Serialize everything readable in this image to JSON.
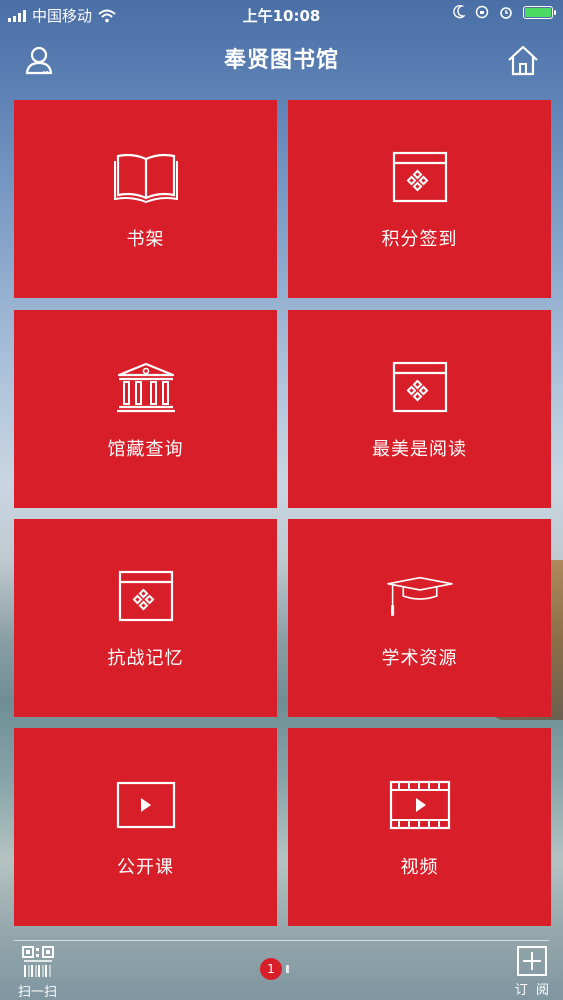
{
  "status_bar": {
    "carrier": "中国移动",
    "time": "上午10:08"
  },
  "header": {
    "title": "奉贤图书馆",
    "left_icon": "user-icon",
    "right_icon": "home-icon"
  },
  "tiles": [
    {
      "label": "书架",
      "icon": "book-icon"
    },
    {
      "label": "积分签到",
      "icon": "window-diamond-icon"
    },
    {
      "label": "馆藏查询",
      "icon": "library-building-icon"
    },
    {
      "label": "最美是阅读",
      "icon": "window-diamond-icon"
    },
    {
      "label": "抗战记忆",
      "icon": "window-diamond-icon"
    },
    {
      "label": "学术资源",
      "icon": "graduation-cap-icon"
    },
    {
      "label": "公开课",
      "icon": "play-icon"
    },
    {
      "label": "视频",
      "icon": "film-icon"
    }
  ],
  "bottom_bar": {
    "scan_label": "扫一扫",
    "subscribe_label": "订  阅",
    "page_number": "1"
  },
  "colors": {
    "tile": "#d81e28",
    "battery": "#4cd964"
  }
}
